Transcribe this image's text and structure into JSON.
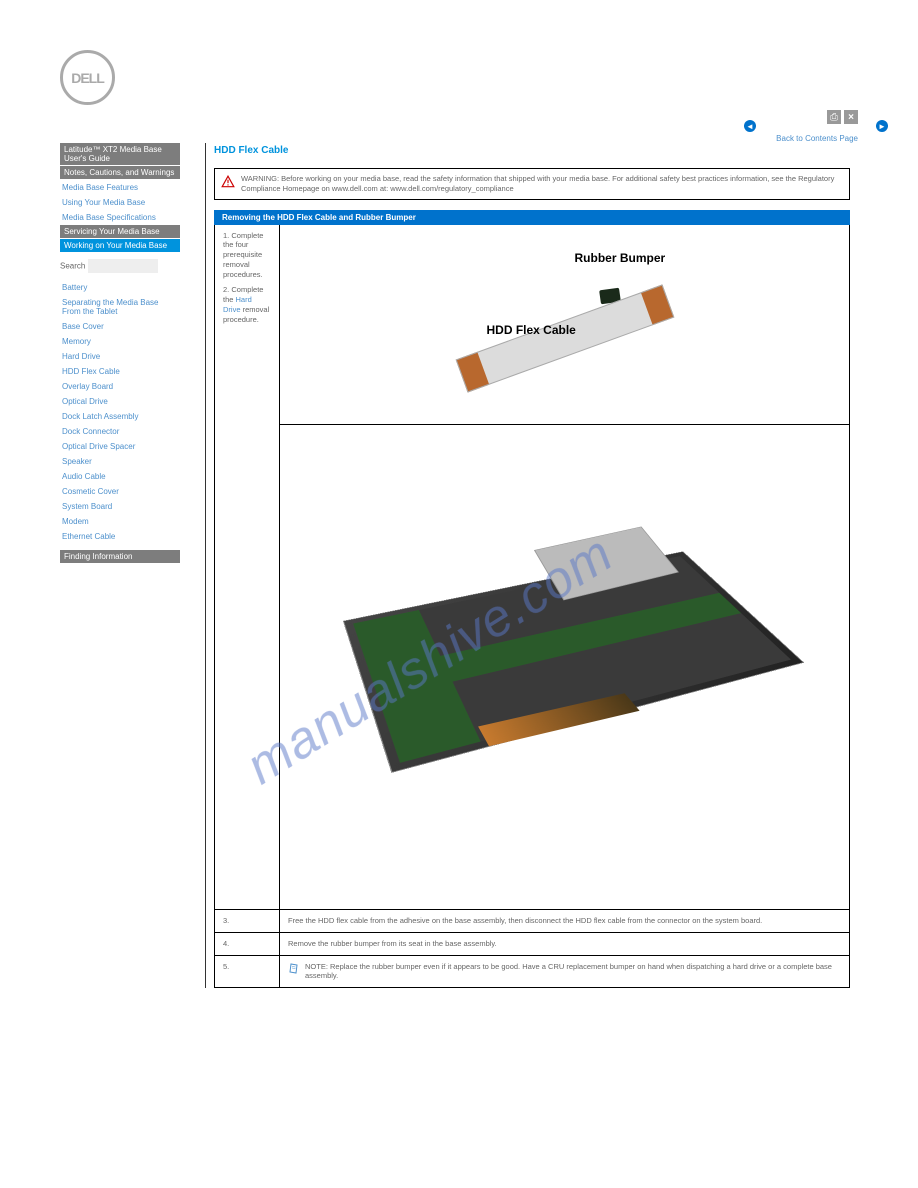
{
  "watermark": "manualshive.com",
  "nav": {
    "back": "Back to Contents Page"
  },
  "logo_text": "DELL",
  "top_icons": {
    "print": "print-icon",
    "close": "close-icon"
  },
  "sidebar": {
    "sections": [
      {
        "head": "Latitude™ XT2 Media Base",
        "sub": "User's Guide"
      },
      {
        "head": "Notes, Cautions, and Warnings"
      }
    ],
    "links1": [
      "Media Base Features",
      "Using Your Media Base",
      "Media Base Specifications"
    ],
    "head2": "Servicing Your Media Base",
    "active": "Working on Your Media Base",
    "search": "Search",
    "links2": [
      "Battery",
      "Separating the Media Base From the Tablet",
      "Base Cover",
      "Memory",
      "Hard Drive",
      "HDD Flex Cable",
      "Overlay Board",
      "Optical Drive",
      "Dock Latch Assembly",
      "Dock Connector",
      "Optical Drive Spacer",
      "Speaker",
      "Audio Cable",
      "Cosmetic Cover",
      "System Board",
      "Modem",
      "Ethernet Cable"
    ],
    "head3": "Finding Information"
  },
  "page": {
    "title": "HDD Flex Cable",
    "warning": "WARNING: Before working on your media base, read the safety information that shipped with your media base. For additional safety best practices information, see the Regulatory Compliance Homepage on www.dell.com at: www.dell.com/regulatory_compliance",
    "section": "Removing the HDD Flex Cable and Rubber Bumper",
    "label_bumper": "Rubber Bumper",
    "label_cable": "HDD Flex Cable",
    "steps": {
      "s1a": "1.",
      "s1b": "Complete the four prerequisite removal procedures.",
      "s2a": "2.",
      "s2b_pre": "Complete the ",
      "s2b_link": "Hard Drive",
      "s2b_post": " removal procedure.",
      "s3a": "3.",
      "s3b": "Free the HDD flex cable from the adhesive on the base assembly, then disconnect the HDD flex cable from the connector on the system board.",
      "s4a": "4.",
      "s4b": "Remove the rubber bumper from its seat in the base assembly.",
      "noteA": "5.",
      "noteB": "NOTE: Replace the rubber bumper even if it appears to be good. Have a CRU replacement bumper on hand when dispatching a hard drive or a complete base assembly."
    }
  }
}
